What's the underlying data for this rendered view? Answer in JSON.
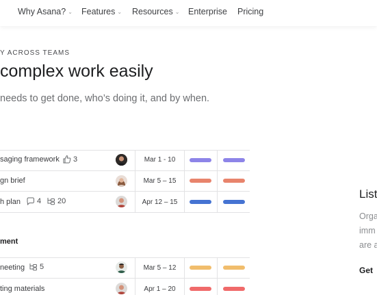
{
  "nav": {
    "items": [
      {
        "label": "Why Asana?",
        "dropdown": true
      },
      {
        "label": "Features",
        "dropdown": true
      },
      {
        "label": "Resources",
        "dropdown": true
      },
      {
        "label": "Enterprise",
        "dropdown": false
      },
      {
        "label": "Pricing",
        "dropdown": false
      }
    ]
  },
  "hero": {
    "eyebrow": "Y ACROSS TEAMS",
    "headline": "complex work easily",
    "subhead": "needs to get done, who’s doing it, and by when."
  },
  "table": {
    "rows": [
      {
        "task": "saging framework",
        "likes": "3",
        "date": "Mar 1 - 10",
        "color": "#8d84e8"
      },
      {
        "task": "gn brief",
        "date": "Mar 5 – 15",
        "color": "#e8846c"
      },
      {
        "task": "h plan",
        "comments": "4",
        "subtasks": "20",
        "date": "Apr 12 – 15",
        "color": "#4573d2"
      }
    ],
    "section2_title": "ment",
    "rows2": [
      {
        "task": "neeting",
        "subtasks": "5",
        "date": "Mar 5 – 12",
        "color": "#f1bd6c"
      },
      {
        "task": "ting materials",
        "date": "Apr 1 – 20",
        "color": "#f06a6a"
      }
    ]
  },
  "side": {
    "title": "List",
    "lines": [
      "Orga",
      "imm",
      "are a"
    ],
    "link": "Get"
  },
  "icons": [
    "chevron-down-icon",
    "thumbs-up-icon",
    "comment-icon",
    "subtask-icon"
  ]
}
